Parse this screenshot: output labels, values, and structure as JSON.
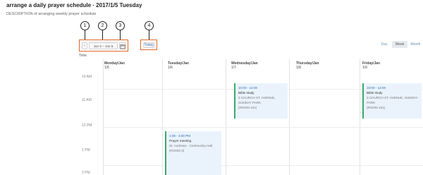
{
  "page": {
    "title": "arrange a daily prayer schedule · 2017/1/5 Tuesday",
    "subtitle": "DESCRIPTION of arranging weekly prayer schedule"
  },
  "callouts": [
    "1",
    "2",
    "3",
    "4"
  ],
  "toolbar": {
    "prev_label": "‹",
    "date_label": "Jan 5 – Jan 9",
    "calendar_icon": "calendar-icon",
    "today_label": "Today"
  },
  "views": [
    "Day",
    "Week",
    "Month"
  ],
  "active_view": "Week",
  "timezone_label": "Time",
  "calendar": {
    "columns": [
      {
        "day": "Monday/Jan",
        "date": "1/5"
      },
      {
        "day": "Tuesday/Jan",
        "date": "1/6"
      },
      {
        "day": "Wednesday/Jan",
        "date": "1/7"
      },
      {
        "day": "Thursday/Jan",
        "date": "1/8"
      },
      {
        "day": "Friday/Jan",
        "date": "1/9"
      }
    ],
    "hours": [
      "10 AM",
      "11 AM",
      "12 PM",
      "1 PM",
      "2 PM"
    ],
    "events": [
      {
        "time": "10:00 - 12:00",
        "title": "Bible study",
        "addr": "3 CHURCH ST. AVENUE, SUNDAY PARK",
        "note": "(ROOM 101)"
      },
      {
        "time": "10:00 - 12:00",
        "title": "Bible study",
        "addr": "3 CHURCH ST. AVENUE, SUNDAY PARK",
        "note": "(ROOM 101)"
      },
      {
        "time": "1:00 - 3:00 PM",
        "title": "Prayer meeting",
        "addr": "St. Andrews · Community Hall",
        "note": "(ROOM 3)"
      }
    ]
  }
}
